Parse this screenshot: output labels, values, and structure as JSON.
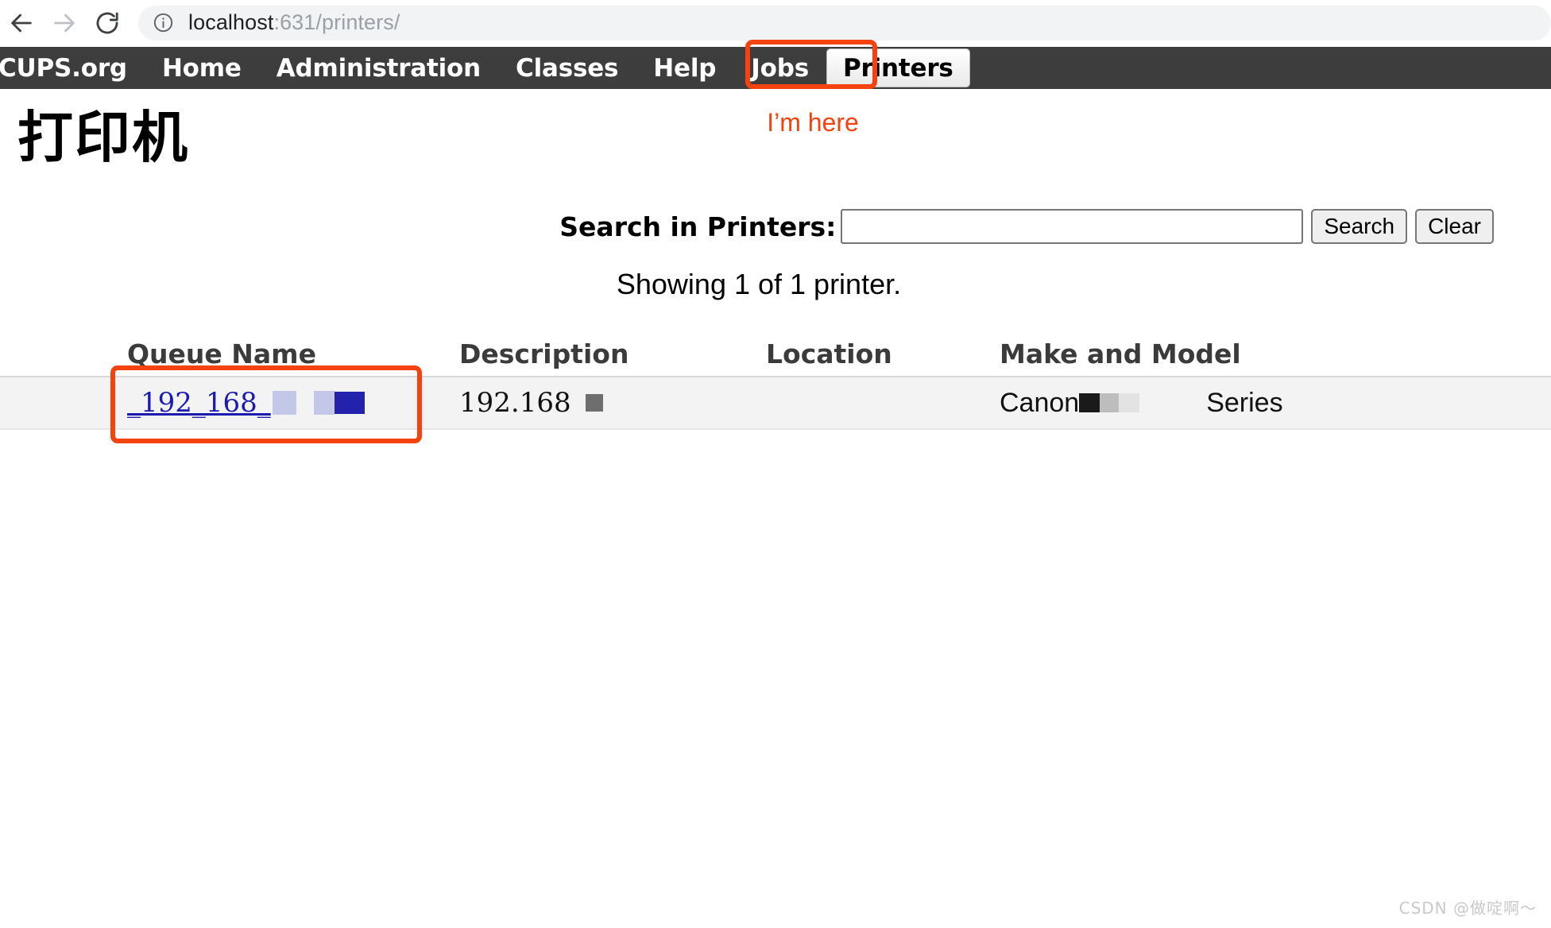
{
  "browser": {
    "back_icon": "arrow-left-icon",
    "forward_icon": "arrow-right-icon",
    "reload_icon": "reload-icon",
    "site_info_icon": "info-circle-icon",
    "url_host": "localhost",
    "url_rest": ":631/printers/",
    "url_full": "localhost:631/printers/"
  },
  "nav": {
    "items": [
      {
        "label": "CUPS.org",
        "active": false
      },
      {
        "label": "Home",
        "active": false
      },
      {
        "label": "Administration",
        "active": false
      },
      {
        "label": "Classes",
        "active": false
      },
      {
        "label": "Help",
        "active": false
      },
      {
        "label": "Jobs",
        "active": false
      },
      {
        "label": "Printers",
        "active": true
      }
    ],
    "background": "#3d3d3d"
  },
  "annotations": {
    "color": "#f4430f",
    "here_label": "I’m here"
  },
  "page": {
    "title": "打印机"
  },
  "search": {
    "label": "Search in Printers:",
    "value": "",
    "placeholder": "",
    "search_button": "Search",
    "clear_button": "Clear"
  },
  "summary": {
    "showing": "Showing 1 of 1 printer."
  },
  "table": {
    "headers": {
      "queue": "Queue Name",
      "description": "Description",
      "location": "Location",
      "make_model": "Make and Model"
    },
    "rows": [
      {
        "queue_name": "_192_168_",
        "queue_name_redacted": true,
        "description": "192.168",
        "description_redacted": true,
        "location": "",
        "make_prefix": "Canon",
        "make_suffix": "Series"
      }
    ]
  },
  "watermark": {
    "text": "CSDN @做啶啊～"
  }
}
